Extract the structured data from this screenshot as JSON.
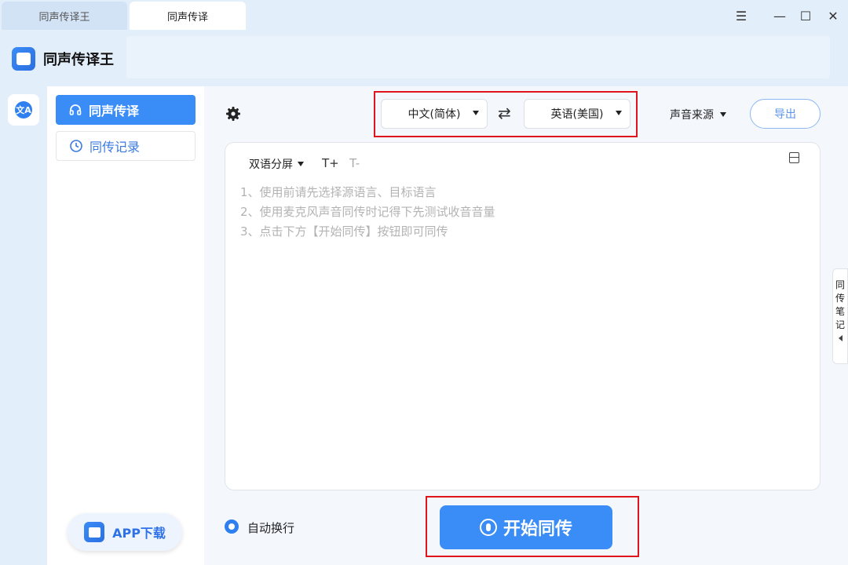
{
  "tabs": [
    {
      "label": "同声传译王"
    },
    {
      "label": "同声传译"
    }
  ],
  "window_controls": {
    "menu": "☰",
    "minimize": "—",
    "maximize": "☐",
    "close": "✕"
  },
  "app": {
    "title": "同声传译王",
    "logo_icon": "app-logo-icon"
  },
  "rail": {
    "translate_icon_glyph": "文A"
  },
  "sidebar": {
    "items": [
      {
        "label": "同声传译",
        "icon": "headphones-icon",
        "active": true
      },
      {
        "label": "同传记录",
        "icon": "clock-icon",
        "active": false
      }
    ],
    "app_download_label": "APP下载"
  },
  "toolbar": {
    "source_lang": "中文(简体)",
    "target_lang": "英语(美国)",
    "swap_glyph": "⇄",
    "voice_source_label": "声音来源",
    "export_label": "导出"
  },
  "panel": {
    "split_mode_label": "双语分屏",
    "font_increase": "T+",
    "font_decrease": "T-",
    "tips": [
      "1、使用前请先选择源语言、目标语言",
      "2、使用麦克风声音同传时记得下先测试收音音量",
      "3、点击下方【开始同传】按钮即可同传"
    ]
  },
  "side_note": {
    "label": "同传笔记"
  },
  "bottom": {
    "auto_wrap_label": "自动换行",
    "auto_wrap_checked": true,
    "start_label": "开始同传"
  },
  "colors": {
    "accent": "#3a8cf7",
    "highlight_box": "#e0141c",
    "background": "#e3eefb"
  }
}
